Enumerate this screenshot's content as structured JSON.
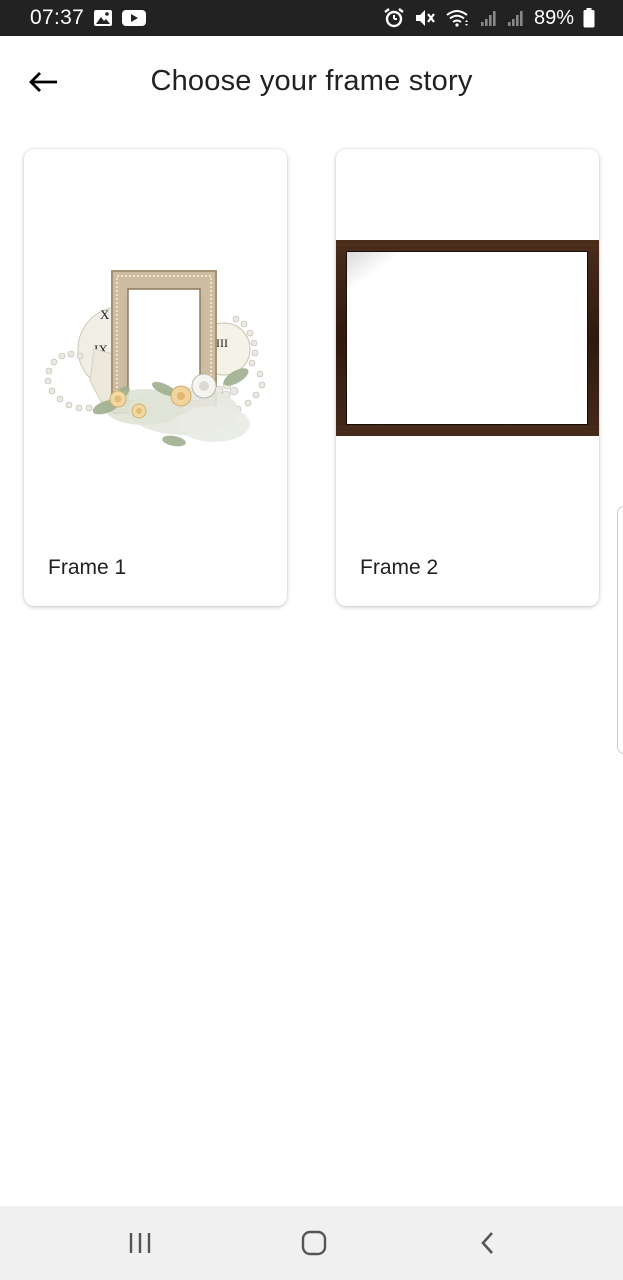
{
  "status_bar": {
    "time": "07:37",
    "battery_text": "89%",
    "left_icons": [
      "gallery-icon",
      "youtube-icon"
    ],
    "right_icons": [
      "alarm-icon",
      "mute-icon",
      "wifi-icon",
      "signal-icon",
      "signal-icon",
      "battery-icon"
    ]
  },
  "header": {
    "title": "Choose your frame story",
    "back_icon": "arrow-left-icon"
  },
  "frames": [
    {
      "label": "Frame 1",
      "style": "vintage-lace-frame"
    },
    {
      "label": "Frame 2",
      "style": "dark-wood-frame"
    }
  ],
  "nav_bar": {
    "icons": [
      "recent-apps-icon",
      "home-icon",
      "back-icon"
    ]
  },
  "colors": {
    "status_bar_bg": "#222222",
    "background": "#ffffff",
    "nav_bar_bg": "#f0f0f0",
    "text": "#212121",
    "wood_frame": "#3d2416"
  }
}
